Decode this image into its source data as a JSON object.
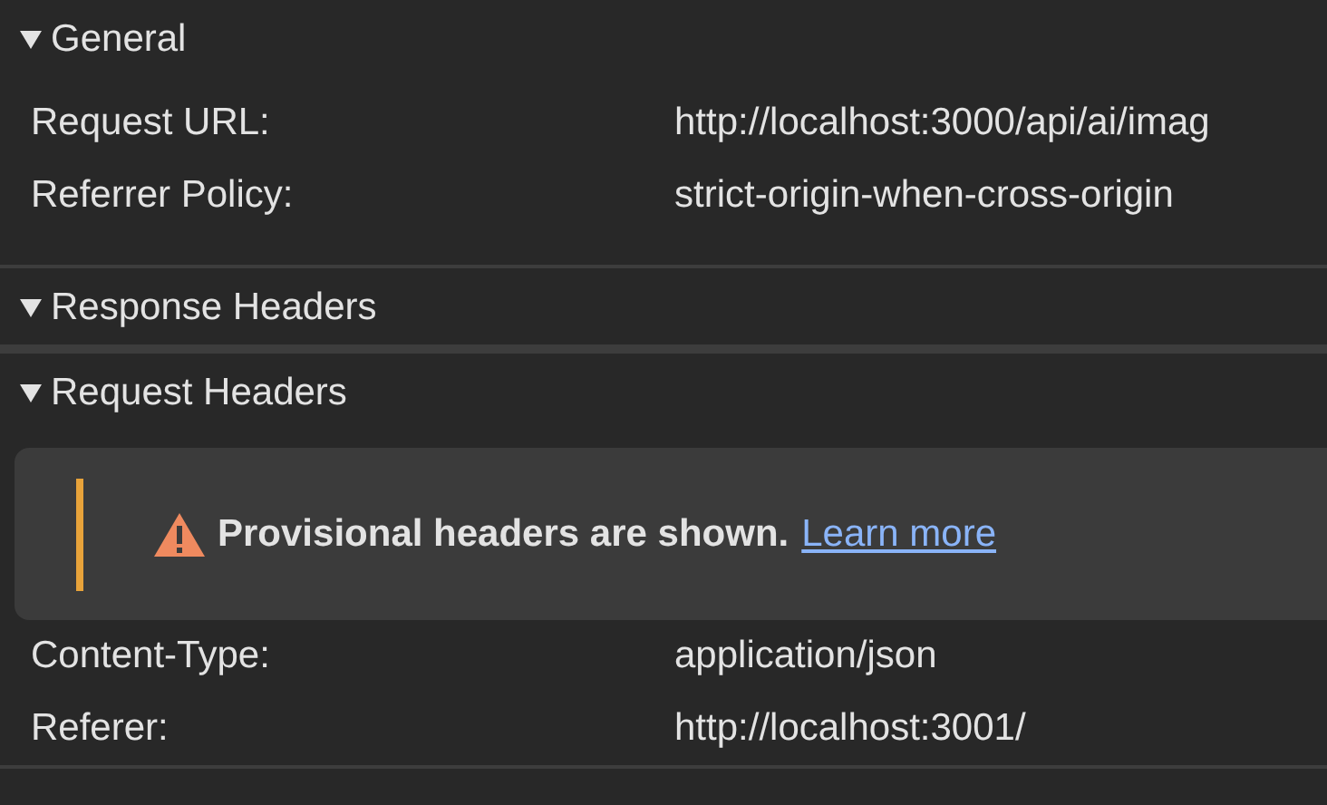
{
  "sections": [
    {
      "title": "General",
      "expanded": true,
      "rows": [
        {
          "name": "Request URL:",
          "value": "http://localhost:3000/api/ai/imag"
        },
        {
          "name": "Referrer Policy:",
          "value": "strict-origin-when-cross-origin"
        }
      ]
    },
    {
      "title": "Response Headers",
      "expanded": true
    },
    {
      "title": "Request Headers",
      "expanded": true,
      "warning": {
        "text": "Provisional headers are shown.",
        "link": "Learn more"
      },
      "rows": [
        {
          "name": "Content-Type:",
          "value": "application/json"
        },
        {
          "name": "Referer:",
          "value": "http://localhost:3001/"
        }
      ]
    }
  ]
}
